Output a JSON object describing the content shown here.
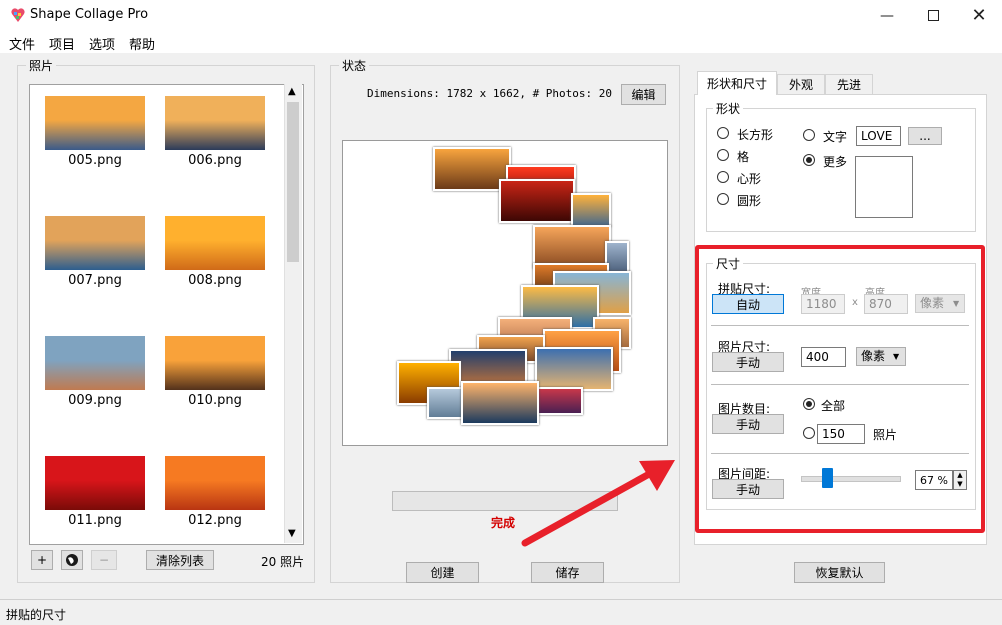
{
  "window": {
    "title": "Shape Collage Pro"
  },
  "menu": [
    "文件",
    "项目",
    "选项",
    "帮助"
  ],
  "photos": {
    "group_label": "照片",
    "items": [
      {
        "label": "005.png",
        "sky": "#f4a742",
        "ground": "#3a5a8a"
      },
      {
        "label": "006.png",
        "sky": "#f0b05a",
        "ground": "#2b3b5a"
      },
      {
        "label": "007.png",
        "sky": "#e2a35a",
        "ground": "#2d5e8f"
      },
      {
        "label": "008.png",
        "sky": "#ffb02e",
        "ground": "#d06a18"
      },
      {
        "label": "009.png",
        "sky": "#7fa3c0",
        "ground": "#c07a50"
      },
      {
        "label": "010.png",
        "sky": "#f9a23a",
        "ground": "#53311c"
      },
      {
        "label": "011.png",
        "sky": "#d8151a",
        "ground": "#7a0b08"
      },
      {
        "label": "012.png",
        "sky": "#f67a22",
        "ground": "#b93512"
      }
    ],
    "count_label": "20 照片",
    "clear_button": "清除列表",
    "add_button": "+",
    "remove_button": "−"
  },
  "status": {
    "group_label": "状态",
    "dimensions_text": "Dimensions: 1782 x 1662, # Photos: 20",
    "edit_button": "编辑",
    "done_text": "完成"
  },
  "actions": {
    "create": "创建",
    "save": "储存",
    "reset": "恢复默认"
  },
  "tabs": [
    {
      "label": "形状和尺寸",
      "active": true
    },
    {
      "label": "外观",
      "active": false
    },
    {
      "label": "先进",
      "active": false
    }
  ],
  "shape": {
    "group_label": "形状",
    "options_left": [
      {
        "label": "长方形",
        "selected": false
      },
      {
        "label": "格",
        "selected": false
      },
      {
        "label": "心形",
        "selected": false
      },
      {
        "label": "圆形",
        "selected": false
      }
    ],
    "text_option": {
      "label": "文字",
      "selected": false
    },
    "text_value": "LOVE",
    "more_option": {
      "label": "更多",
      "selected": true
    },
    "browse_button": "..."
  },
  "size": {
    "group_label": "尺寸",
    "collage_size": {
      "label": "拼贴尺寸:",
      "button": "自动",
      "width_label": "宽度",
      "height_label": "高度",
      "width": "1180",
      "x": "x",
      "height": "870",
      "unit": "像素"
    },
    "photo_size": {
      "label": "照片尺寸:",
      "button": "手动",
      "value": "400",
      "unit": "像素"
    },
    "photo_count": {
      "label": "图片数目:",
      "button": "手动",
      "all_label": "全部",
      "all_selected": true,
      "count_value": "150",
      "count_unit": "照片"
    },
    "photo_spacing": {
      "label": "图片间距:",
      "button": "手动",
      "value": "67 %",
      "level": 0.3
    }
  },
  "statusbar": {
    "text": "拼贴的尺寸"
  },
  "colors": {
    "highlight_red": "#e8202a",
    "accent_blue": "#0078d7",
    "done_red": "#d40000"
  }
}
